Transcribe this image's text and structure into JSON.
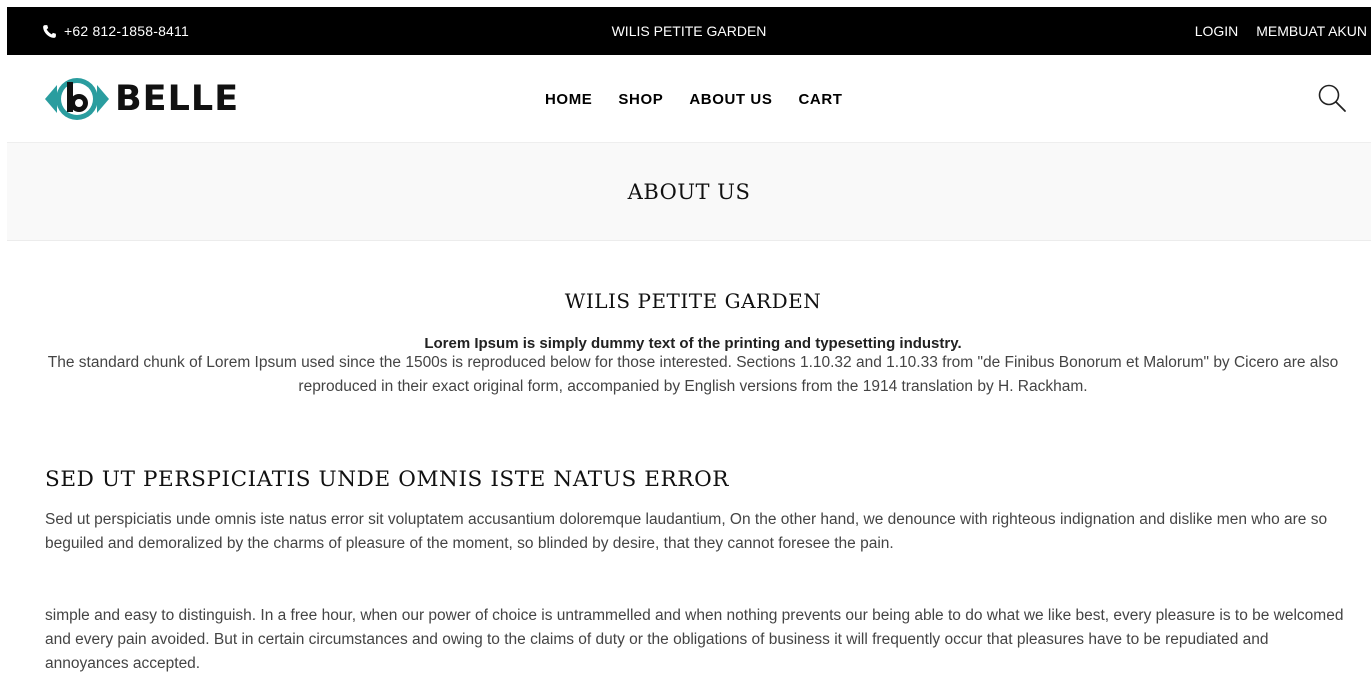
{
  "topbar": {
    "phone": "+62 812-1858-8411",
    "store_name": "WILIS PETITE GARDEN",
    "login": "LOGIN",
    "register": "MEMBUAT AKUN"
  },
  "header": {
    "logo_text": "BELLE",
    "nav": {
      "home": "HOME",
      "shop": "SHOP",
      "about": "ABOUT US",
      "cart": "CART"
    },
    "icons": {
      "phone": "phone-icon",
      "search": "search-icon",
      "logo": "belle-logo-icon"
    }
  },
  "banner": {
    "title": "ABOUT US"
  },
  "content": {
    "heading": "WILIS PETITE GARDEN",
    "tagline": "Lorem Ipsum is simply dummy text of the printing and typesetting industry.",
    "intro": "The standard chunk of Lorem Ipsum used since the 1500s is reproduced below for those interested. Sections 1.10.32 and 1.10.33 from \"de Finibus Bonorum et Malorum\" by Cicero are also reproduced in their exact original form, accompanied by English versions from the 1914 translation by H. Rackham.",
    "section_title": "SED UT PERSPICIATIS UNDE OMNIS ISTE NATUS ERROR",
    "paragraph1": "Sed ut perspiciatis unde omnis iste natus error sit voluptatem accusantium doloremque laudantium, On the other hand, we denounce with righteous indignation and dislike men who are so beguiled and demoralized by the charms of pleasure of the moment, so blinded by desire, that they cannot foresee the pain.",
    "paragraph2": "simple and easy to distinguish. In a free hour, when our power of choice is untrammelled and when nothing prevents our being able to do what we like best, every pleasure is to be welcomed and every pain avoided. But in certain circumstances and owing to the claims of duty or the obligations of business it will frequently occur that pleasures have to be repudiated and annoyances accepted."
  },
  "colors": {
    "topbar_bg": "#000000",
    "logo_teal": "#2a9d9f",
    "banner_bg": "#f9f9f9"
  }
}
